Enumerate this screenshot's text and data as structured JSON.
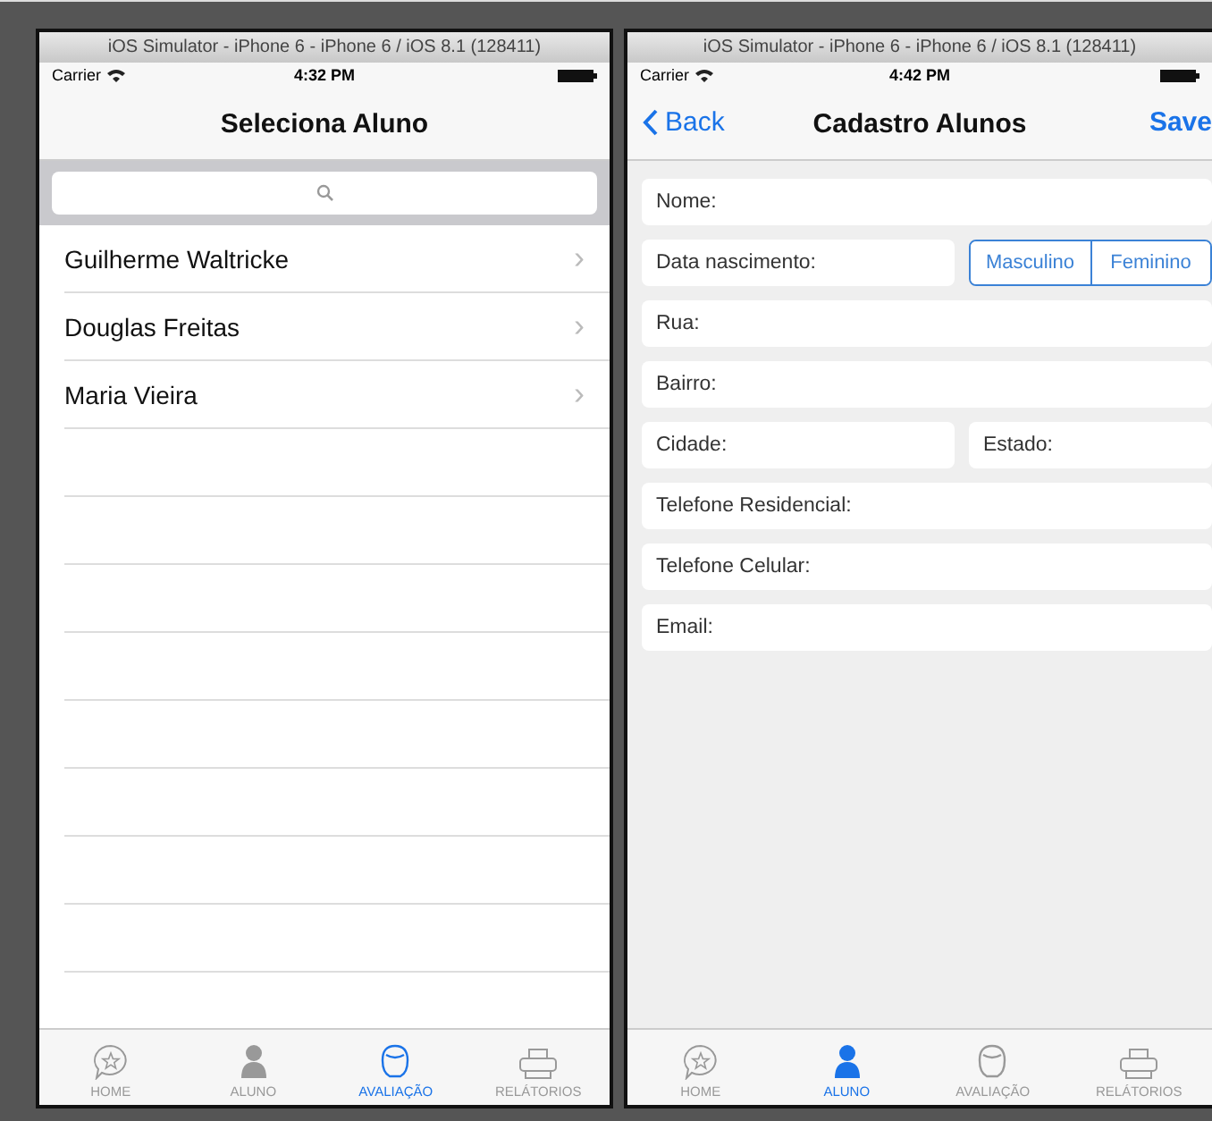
{
  "left_window": {
    "title": "iOS Simulator - iPhone 6 - iPhone 6 / iOS 8.1 (128411)",
    "status_bar": {
      "carrier": "Carrier",
      "time": "4:32 PM"
    },
    "nav_title": "Seleciona Aluno",
    "list": [
      {
        "name": "Guilherme Waltricke",
        "chevron": "›"
      },
      {
        "name": "Douglas Freitas",
        "chevron": "›"
      },
      {
        "name": "Maria Vieira",
        "chevron": "›"
      }
    ],
    "tabs": [
      {
        "label": "HOME",
        "selected": false
      },
      {
        "label": "ALUNO",
        "selected": false
      },
      {
        "label": "AVALIAÇÃO",
        "selected": true
      },
      {
        "label": "RELÁTORIOS",
        "selected": false
      }
    ]
  },
  "right_window": {
    "title": "iOS Simulator - iPhone 6 - iPhone 6 / iOS 8.1 (128411)",
    "status_bar": {
      "carrier": "Carrier",
      "time": "4:42 PM"
    },
    "back": "Back",
    "nav_title": "Cadastro Alunos",
    "save": "Save",
    "form_rows": [
      {
        "items": [
          {
            "kind": "field",
            "placeholder": "Nome:"
          }
        ]
      },
      {
        "items": [
          {
            "kind": "field",
            "placeholder": "Data nascimento:"
          },
          {
            "kind": "segmented",
            "options": [
              {
                "label": "Masculino",
                "selected": false
              },
              {
                "label": "Feminino",
                "selected": false
              }
            ]
          }
        ]
      },
      {
        "items": [
          {
            "kind": "field",
            "placeholder": "Rua:"
          }
        ]
      },
      {
        "items": [
          {
            "kind": "field",
            "placeholder": "Bairro:"
          }
        ]
      },
      {
        "items": [
          {
            "kind": "field",
            "placeholder": "Cidade:"
          },
          {
            "kind": "field",
            "placeholder": "Estado:"
          }
        ]
      },
      {
        "items": [
          {
            "kind": "field",
            "placeholder": "Telefone Residencial:"
          }
        ]
      },
      {
        "items": [
          {
            "kind": "field",
            "placeholder": "Telefone Celular:"
          }
        ]
      },
      {
        "items": [
          {
            "kind": "field",
            "placeholder": "Email:"
          }
        ]
      }
    ],
    "tabs": [
      {
        "label": "HOME",
        "selected": false
      },
      {
        "label": "ALUNO",
        "selected": true
      },
      {
        "label": "AVALIAÇÃO",
        "selected": false
      },
      {
        "label": "RELÁTORIOS",
        "selected": false
      }
    ]
  }
}
